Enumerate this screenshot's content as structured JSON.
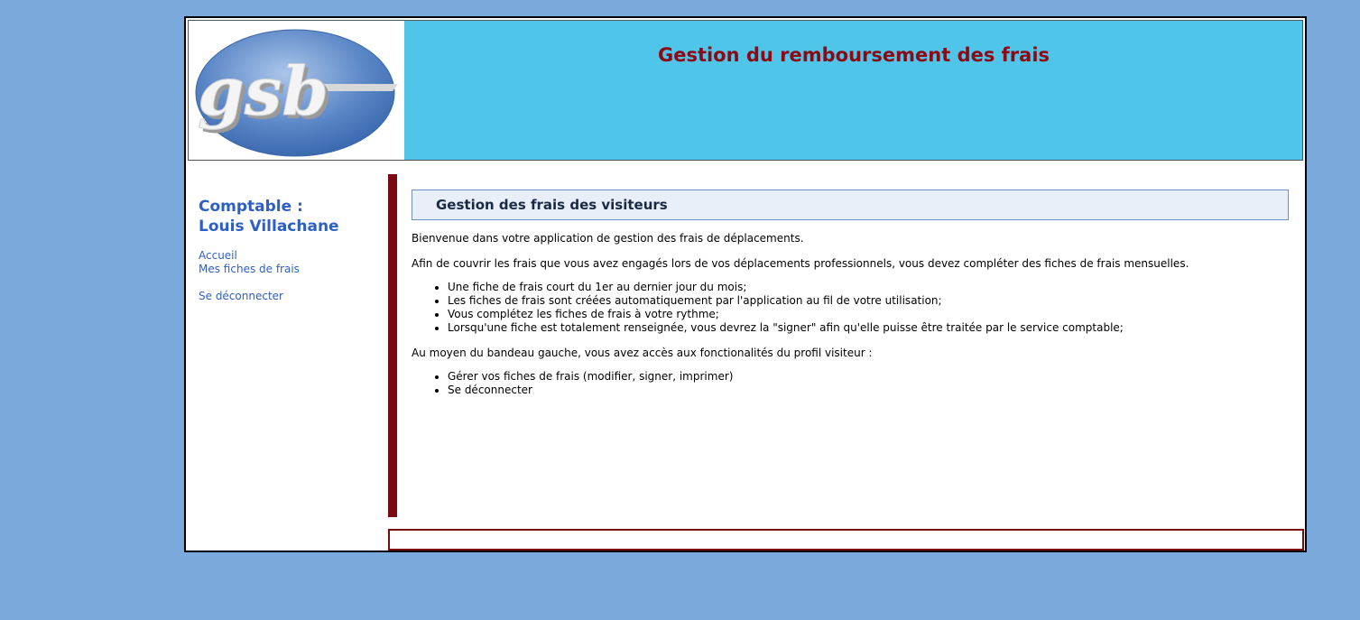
{
  "header": {
    "logo_text": "gsb",
    "title": "Gestion du remboursement des frais"
  },
  "sidebar": {
    "role": "Comptable :",
    "user_name": "Louis Villachane",
    "menu": {
      "home": "Accueil",
      "my_expense_reports": "Mes fiches de frais",
      "logout": "Se déconnecter"
    }
  },
  "content": {
    "heading": "Gestion des frais des visiteurs",
    "intro": "Bienvenue dans votre application de gestion des frais de déplacements.",
    "purpose": "Afin de couvrir les frais que vous avez engagés lors de vos déplacements professionnels, vous devez compléter des fiches de frais mensuelles.",
    "rules": [
      "Une fiche de frais court du 1er au dernier jour du mois;",
      "Les fiches de frais sont créées automatiquement par l'application au fil de votre utilisation;",
      "Vous complétez les fiches de frais à votre rythme;",
      "Lorsqu'une fiche est totalement renseignée, vous devrez la \"signer\" afin qu'elle puisse être traitée par le service comptable;"
    ],
    "features_intro": "Au moyen du bandeau gauche, vous avez accès aux fonctionalités du profil visiteur :",
    "features": [
      "Gérer vos fiches de frais (modifier, signer, imprimer)",
      "Se déconnecter"
    ]
  },
  "colors": {
    "background": "#7aaadc",
    "header": "#50c5ea",
    "title": "#8b0a14",
    "accent": "#7a0a10",
    "link": "#2d5fc4"
  }
}
